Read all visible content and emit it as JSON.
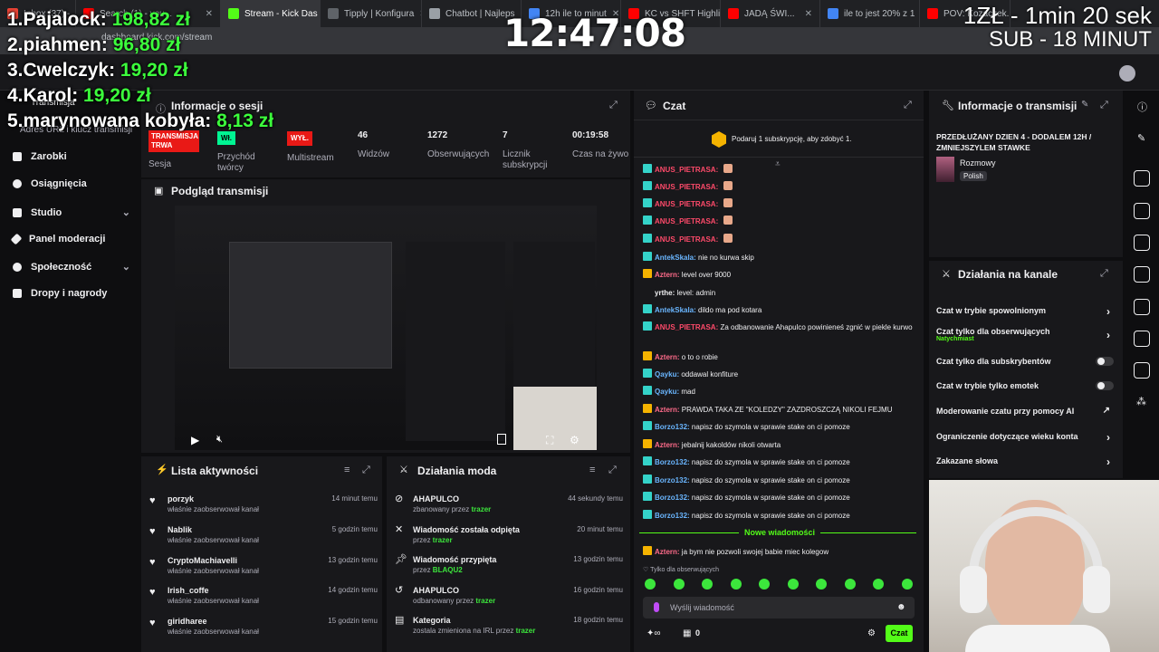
{
  "browser": {
    "tabs": [
      "Inbox (37) - ...",
      "Search (1) - you...",
      "Stream - Kick Das",
      "Tipply | Konfigura",
      "Chatbot | Najleps",
      "12h ile to minut",
      "KC vs SHFT Highli",
      "JADĄ ŚWI...",
      "ile to jest 20% z 1",
      "POV: Kozaczek..."
    ],
    "url": "dashboard.kick.com/stream"
  },
  "overlay": {
    "leaderboard": [
      {
        "rank": "1.",
        "name": "Pajalock:",
        "amount": "198,82 zł"
      },
      {
        "rank": "2.",
        "name": "piahmen:",
        "amount": "96,80 zł"
      },
      {
        "rank": "3.",
        "name": "Cwelczyk:",
        "amount": "19,20 zł"
      },
      {
        "rank": "4.",
        "name": "Karol:",
        "amount": "19,20 zł"
      },
      {
        "rank": "5.",
        "name": "marynowana kobyła:",
        "amount": "8,13 zł"
      }
    ],
    "clock": "12:47:08",
    "sub_line1": "1ZŁ - 1min 20 sek",
    "sub_line2": "SUB - 18 MINUT"
  },
  "nav": {
    "items": [
      {
        "label": "Transmisja",
        "chevron": false
      },
      {
        "label": "Adres URL i klucz transmisji",
        "chevron": false
      },
      {
        "label": "Zarobki",
        "chevron": false
      },
      {
        "label": "Osiągnięcia",
        "chevron": false
      },
      {
        "label": "Studio",
        "chevron": true
      },
      {
        "label": "Panel moderacji",
        "chevron": false
      },
      {
        "label": "Społeczność",
        "chevron": true
      },
      {
        "label": "Dropy i nagrody",
        "chevron": false
      }
    ]
  },
  "session": {
    "title": "Informacje o sesji",
    "stats": [
      {
        "value": "TRANSMISJA TRWA",
        "label": "Sesja"
      },
      {
        "value": "Wł.",
        "label": "Przychód twórcy"
      },
      {
        "value": "WYŁ.",
        "label": "Multistream"
      },
      {
        "value": "46",
        "label": "Widzów"
      },
      {
        "value": "1272",
        "label": "Obserwujących"
      },
      {
        "value": "7",
        "label": "Licznik subskrypcji"
      },
      {
        "value": "00:19:58",
        "label": "Czas na żywo"
      }
    ]
  },
  "preview": {
    "title": "Podgląd transmisji"
  },
  "activity": {
    "title": "Lista aktywności",
    "items": [
      {
        "name": "porzyk",
        "desc": "właśnie zaobserwował kanał",
        "time": "14 minut temu"
      },
      {
        "name": "Nablik",
        "desc": "właśnie zaobserwował kanał",
        "time": "5 godzin temu"
      },
      {
        "name": "CryptoMachiavelli",
        "desc": "właśnie zaobserwował kanał",
        "time": "13 godzin temu"
      },
      {
        "name": "Irish_coffe",
        "desc": "właśnie zaobserwował kanał",
        "time": "14 godzin temu"
      },
      {
        "name": "giridharee",
        "desc": "właśnie zaobserwował kanał",
        "time": "15 godzin temu"
      }
    ]
  },
  "modactions": {
    "title": "Działania moda",
    "items": [
      {
        "name": "AHAPULCO",
        "desc": "zbanowany przez",
        "by": "trazer",
        "time": "44 sekundy temu"
      },
      {
        "name": "Wiadomość została odpięta",
        "desc": "przez",
        "by": "trazer",
        "time": "20 minut temu"
      },
      {
        "name": "Wiadomość przypięta",
        "desc": "przez",
        "by": "BLAQU2",
        "time": "13 godzin temu"
      },
      {
        "name": "AHAPULCO",
        "desc": "odbanowany przez",
        "by": "trazer",
        "time": "16 godzin temu"
      },
      {
        "name": "Kategoria",
        "desc": "zostala zmieniona na IRL przez",
        "by": "trazer",
        "time": "18 godzin temu"
      }
    ]
  },
  "chat": {
    "title": "Czat",
    "banner": "Podaruj 1 subskrypcję, aby zdobyć 1.",
    "messages": [
      {
        "user": "ANUS_PIETRASA:",
        "text": "",
        "color": "#ff4a6a"
      },
      {
        "user": "ANUS_PIETRASA:",
        "text": "",
        "color": "#ff4a6a"
      },
      {
        "user": "ANUS_PIETRASA:",
        "text": "",
        "color": "#ff4a6a"
      },
      {
        "user": "ANUS_PIETRASA:",
        "text": "",
        "color": "#ff4a6a"
      },
      {
        "user": "ANUS_PIETRASA:",
        "text": "",
        "color": "#ff4a6a"
      },
      {
        "user": "AntekSkala:",
        "text": "nie no kurwa skip",
        "color": "#6ab6ff"
      },
      {
        "user": "Aztern:",
        "text": "level over 9000",
        "color": "#ff6b8a"
      },
      {
        "user": "yrthe:",
        "text": "level: admin",
        "color": "#efeff1"
      },
      {
        "user": "AntekSkala:",
        "text": "dildo ma pod kotara",
        "color": "#6ab6ff"
      },
      {
        "user": "ANUS_PIETRASA:",
        "text": "Za odbanowanie Ahapulco powinieneś zgnić w piekle kurwo",
        "color": "#ff4a6a"
      },
      {
        "user": "Aztern:",
        "text": "o to o robie",
        "color": "#ff6b8a"
      },
      {
        "user": "Qayku:",
        "text": "oddawal konfiture",
        "color": "#6ab6ff"
      },
      {
        "user": "Qayku:",
        "text": "mad",
        "color": "#6ab6ff"
      },
      {
        "user": "Aztern:",
        "text": "PRAWDA TAKA ZE \"KOLEDZY\" ZAZDROSZCZĄ NIKOLI FEJMU",
        "color": "#ff6b8a"
      },
      {
        "user": "Borzo132:",
        "text": "napisz do szymola w sprawie stake on ci pomoze",
        "color": "#6ab6ff"
      },
      {
        "user": "Aztern:",
        "text": "jebalnij kakoldów nikoli otwarta",
        "color": "#ff6b8a"
      },
      {
        "user": "Borzo132:",
        "text": "napisz do szymola w sprawie stake on ci pomoze",
        "color": "#6ab6ff"
      },
      {
        "user": "Borzo132:",
        "text": "napisz do szymola w sprawie stake on ci pomoze",
        "color": "#6ab6ff"
      },
      {
        "user": "Borzo132:",
        "text": "napisz do szymola w sprawie stake on ci pomoze",
        "color": "#6ab6ff"
      },
      {
        "user": "Borzo132:",
        "text": "napisz do szymola w sprawie stake on ci pomoze",
        "color": "#6ab6ff"
      }
    ],
    "new_messages": "Nowe wiadomości",
    "last": {
      "user": "Aztern:",
      "text": "ja bym nie pozwoli swojej babie miec kolegow",
      "color": "#ff6b8a"
    },
    "followers_only": "Tylko dla obserwujących",
    "input_placeholder": "Wyślij wiadomość",
    "count": "0",
    "send_label": "Czat"
  },
  "streaminfo": {
    "title": "Informacje o transmisji",
    "stream_title": "PRZEDŁUŻANY DZIEN 4 - DODALEM 12H / ZMNIEJSZYLEM STAWKE",
    "category": "Rozmowy",
    "language": "Polish"
  },
  "channel": {
    "title": "Działania na kanale",
    "rows": [
      {
        "label": "Czat w trybie spowolnionym",
        "sub": "",
        "control": "chevron"
      },
      {
        "label": "Czat tylko dla obserwujących",
        "sub": "Natychmiast",
        "control": "chevron"
      },
      {
        "label": "Czat tylko dla subskrybentów",
        "sub": "",
        "control": "toggle"
      },
      {
        "label": "Czat w trybie tylko emotek",
        "sub": "",
        "control": "toggle"
      },
      {
        "label": "Moderowanie czatu przy pomocy AI",
        "sub": "",
        "control": "external"
      },
      {
        "label": "Ograniczenie dotyczące wieku konta",
        "sub": "",
        "control": "chevron"
      },
      {
        "label": "Zakazane słowa",
        "sub": "",
        "control": "chevron"
      }
    ]
  },
  "colors": {
    "accent": "#53fc18",
    "bg": "#0e0e10",
    "panel": "#18181b",
    "live_red": "#e91916"
  }
}
